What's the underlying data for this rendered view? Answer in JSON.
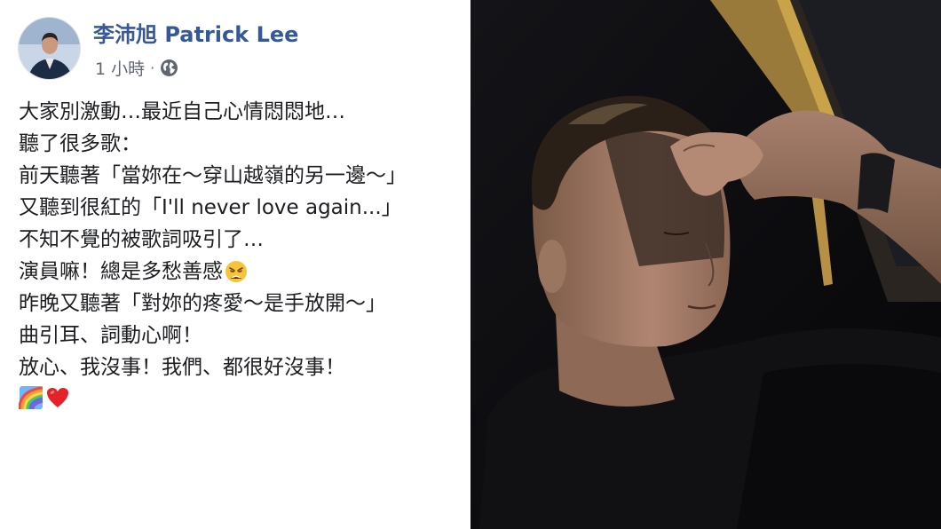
{
  "author": {
    "name": "李沛旭 Patrick Lee",
    "avatar_icon": "profile-photo-avatar"
  },
  "meta": {
    "time": "1 小時",
    "separator": "·",
    "privacy_icon": "globe-icon"
  },
  "post": {
    "lines": [
      "大家別激動…最近自己心情悶悶地…",
      "聽了很多歌：",
      "前天聽著「當妳在～穿山越嶺的另一邊～」",
      "又聽到很紅的「I'll never love again...」",
      "不知不覺的被歌詞吸引了…",
      "演員嘛！總是多愁善感",
      "昨晚又聽著「對妳的疼愛～是手放開～」",
      "曲引耳、詞動心啊！",
      "放心、我沒事！我們、都很好沒事！"
    ],
    "inline_emoji": "weary-face-emoji",
    "trailing_emojis": [
      "rainbow-emoji",
      "red-heart-emoji"
    ]
  },
  "photo": {
    "subject": "man-resting-hand-on-forehead-photo"
  },
  "colors": {
    "author_link": "#365899",
    "text": "#1c1e21",
    "meta": "#606770",
    "photo_bg": "#0b0b0e"
  }
}
